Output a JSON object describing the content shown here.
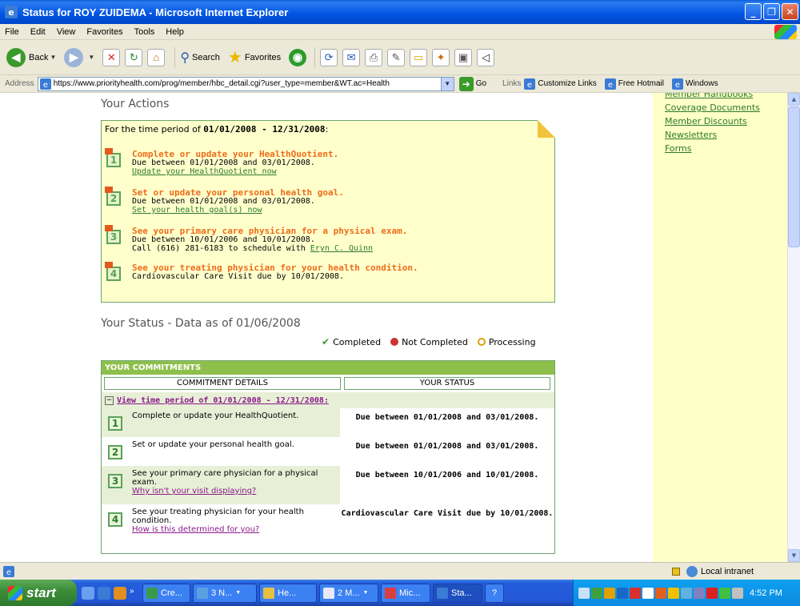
{
  "window": {
    "title": "Status for ROY ZUIDEMA - Microsoft Internet Explorer"
  },
  "menu": [
    "File",
    "Edit",
    "View",
    "Favorites",
    "Tools",
    "Help"
  ],
  "toolbar": {
    "back": "Back",
    "search": "Search",
    "favorites": "Favorites"
  },
  "address": {
    "label": "Address",
    "url": "https://www.priorityhealth.com/prog/member/hbc_detail.cgi?user_type=member&WT.ac=Health",
    "go": "Go",
    "links_label": "Links",
    "links": [
      "Customize Links",
      "Free Hotmail",
      "Windows"
    ]
  },
  "sidebar": {
    "links": [
      "Member Handbooks",
      "Coverage Documents",
      "Member Discounts",
      "Newsletters",
      "Forms"
    ]
  },
  "actions": {
    "title": "Your Actions",
    "period_prefix": "For the time period of",
    "period": "01/01/2008 - 12/31/2008",
    "period_suffix": ":",
    "items": [
      {
        "num": "1",
        "head": "Complete or update your HealthQuotient.",
        "line": "Due between 01/01/2008 and 03/01/2008.",
        "link": "Update your HealthQuotient now"
      },
      {
        "num": "2",
        "head": "Set or update your personal health goal.",
        "line": "Due between 01/01/2008 and 03/01/2008.",
        "link": "Set your health goal(s) now"
      },
      {
        "num": "3",
        "head": "See your primary care physician for a physical exam.",
        "line": "Due between 10/01/2006 and 10/01/2008.",
        "line2_prefix": "Call (616) 281-6183 to schedule with",
        "link": "Eryn C. Quinn"
      },
      {
        "num": "4",
        "head": "See your treating physician for your health condition.",
        "line": "Cardiovascular Care Visit due by 10/01/2008."
      }
    ]
  },
  "status": {
    "title": "Your Status - Data as of 01/06/2008",
    "legend": {
      "completed": "Completed",
      "not_completed": "Not Completed",
      "processing": "Processing"
    }
  },
  "commitments": {
    "header": "YOUR COMMITMENTS",
    "col1": "COMMITMENT DETAILS",
    "col2": "YOUR STATUS",
    "period_link": "View time period of 01/01/2008 - 12/31/2008:",
    "rows": [
      {
        "num": "1",
        "detail": "Complete or update your HealthQuotient.",
        "status": "Due between 01/01/2008 and 03/01/2008."
      },
      {
        "num": "2",
        "detail": "Set or update your personal health goal.",
        "status": "Due between 01/01/2008 and 03/01/2008."
      },
      {
        "num": "3",
        "detail": "See your primary care physician for a physical exam.",
        "link": "Why isn't your visit displaying?",
        "status": "Due between 10/01/2006 and 10/01/2008."
      },
      {
        "num": "4",
        "detail": "See your treating physician for your health condition.",
        "link": "How is this determined for you?",
        "status": "Cardiovascular Care Visit due by 10/01/2008."
      }
    ]
  },
  "statusbar": {
    "zone": "Local intranet"
  },
  "taskbar": {
    "start": "start",
    "tasks": [
      "Cre...",
      "3 N...",
      "He...",
      "2 M...",
      "Mic...",
      "Sta..."
    ],
    "clock": "4:52 PM"
  },
  "colors": {
    "title_blue": "#0054e3",
    "link_green": "#2d7a2d",
    "action_orange": "#ee6c1a",
    "commit_header_green": "#8ebf4a",
    "sidebar_yellow": "#ffffc8"
  }
}
